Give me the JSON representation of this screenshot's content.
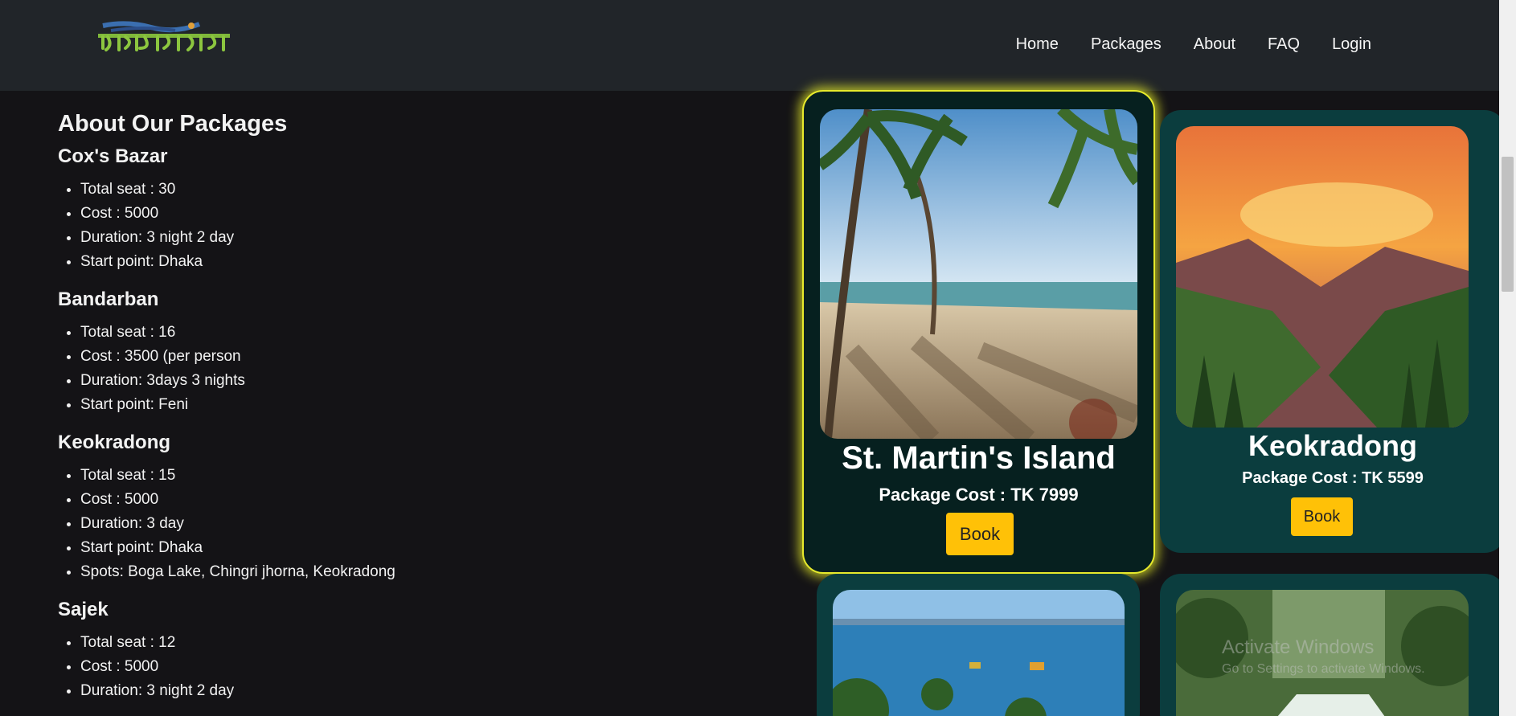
{
  "navbar": {
    "logo_text": "সফরনামা",
    "links": [
      "Home",
      "Packages",
      "About",
      "FAQ",
      "Login"
    ]
  },
  "about": {
    "title": "About Our Packages",
    "packages": [
      {
        "name": "Cox's Bazar",
        "items": [
          "Total seat : 30",
          "Cost : 5000",
          "Duration: 3 night 2 day",
          "Start point: Dhaka"
        ]
      },
      {
        "name": "Bandarban",
        "items": [
          "Total seat : 16",
          "Cost : 3500 (per person",
          "Duration: 3days 3 nights",
          "Start point: Feni"
        ]
      },
      {
        "name": "Keokradong",
        "items": [
          "Total seat : 15",
          "Cost : 5000",
          "Duration: 3 day",
          "Start point: Dhaka",
          "Spots: Boga Lake, Chingri jhorna, Keokradong"
        ]
      },
      {
        "name": "Sajek",
        "items": [
          "Total seat : 12",
          "Cost : 5000",
          "Duration: 3 night 2 day"
        ]
      }
    ]
  },
  "cards": [
    {
      "name": "St. Martin's Island",
      "cost": "Package Cost : TK 7999",
      "button": "Book"
    },
    {
      "name": "Keokradong",
      "cost": "Package Cost : TK 5599",
      "button": "Book"
    }
  ],
  "watermark": {
    "title": "Activate Windows",
    "subtitle": "Go to Settings to activate Windows."
  }
}
